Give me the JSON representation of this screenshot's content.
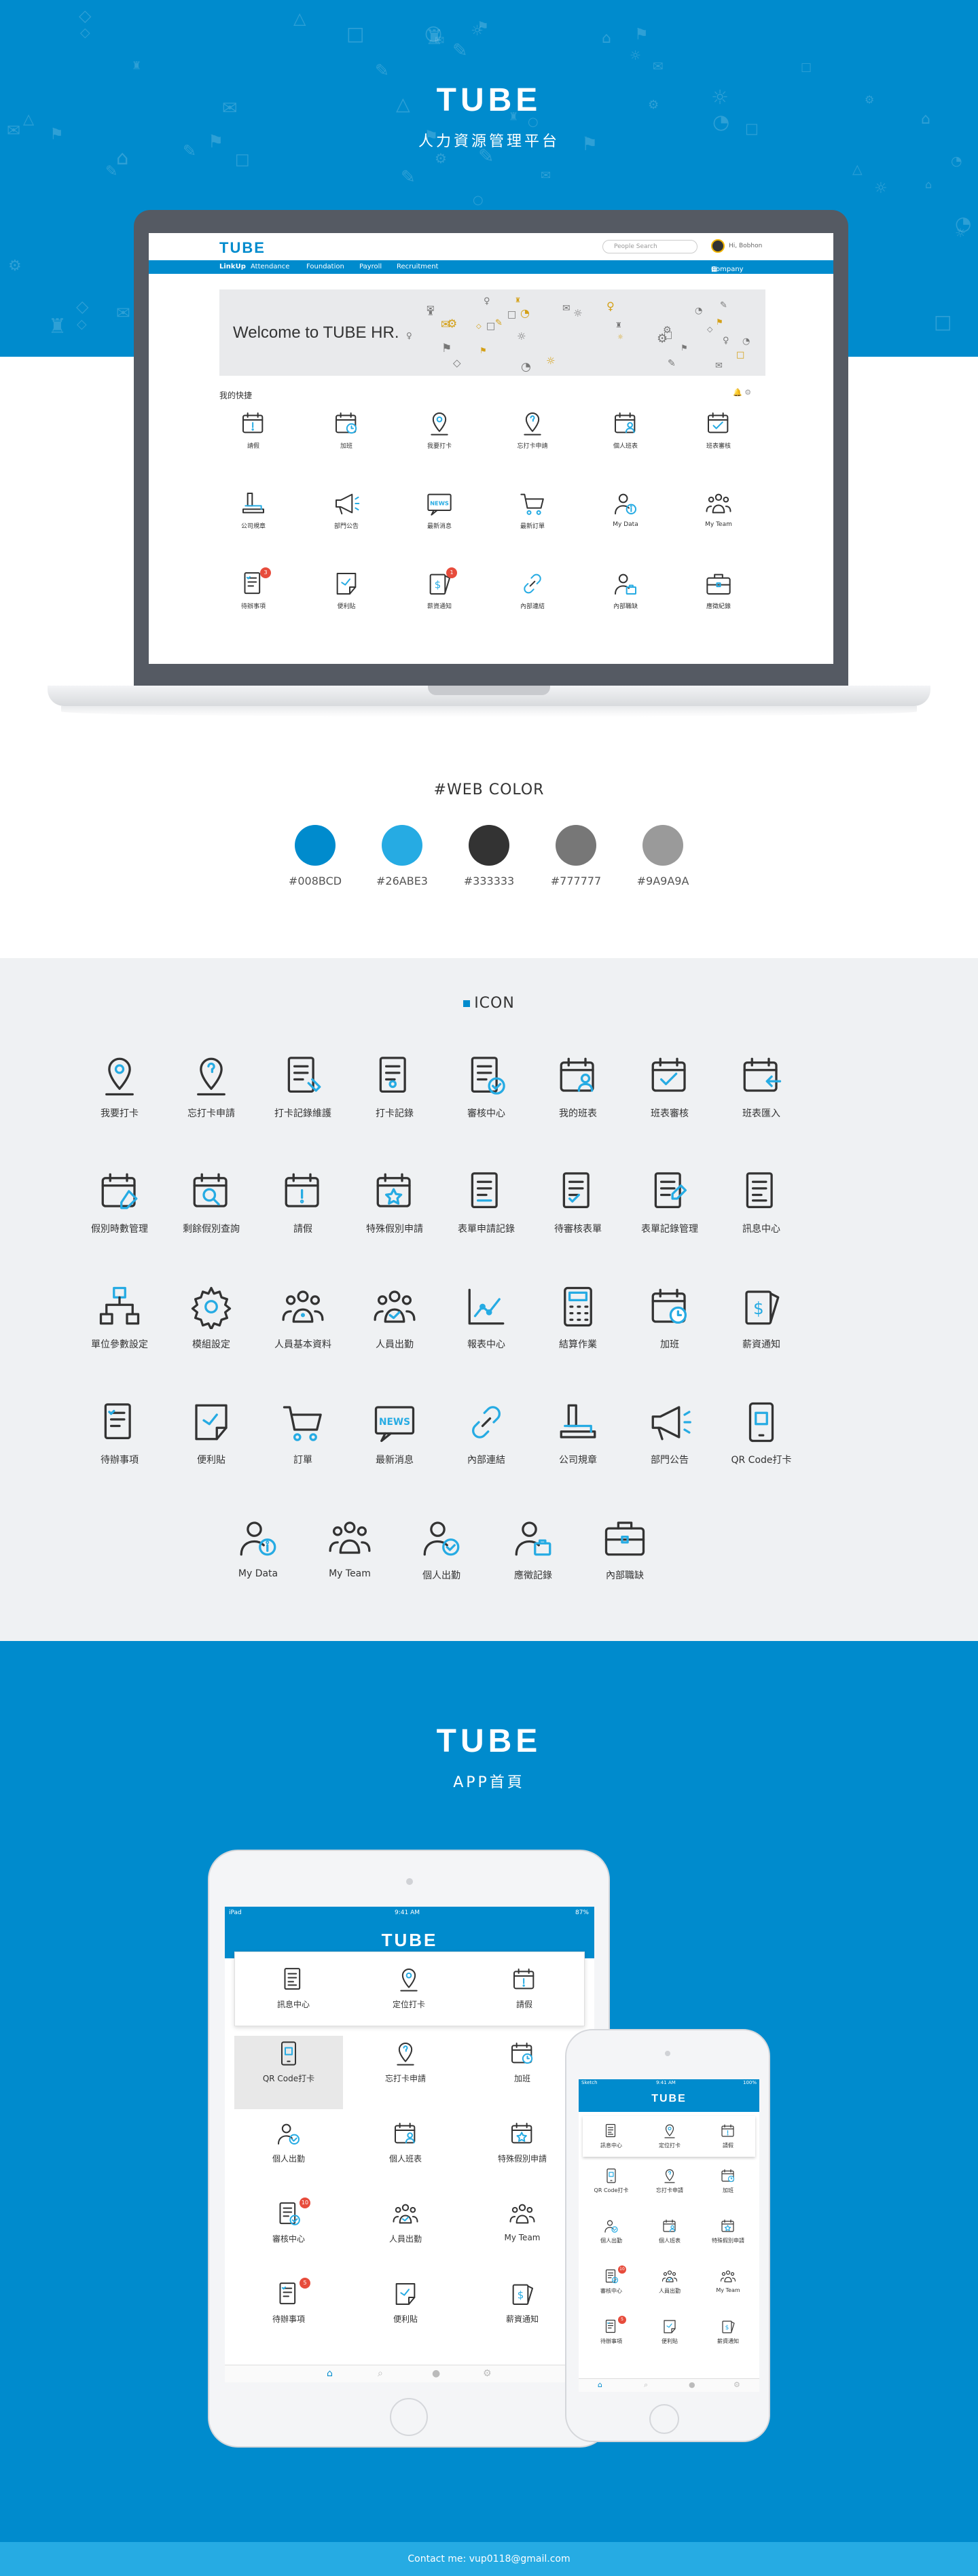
{
  "hero": {
    "logo": "TUBE",
    "subtitle": "人力資源管理平台"
  },
  "screen": {
    "logo": "TUBE",
    "search_placeholder": "People Search",
    "user_name": "Hi, Bobhon",
    "nav": [
      "LinkUp",
      "Attendance",
      "Foundation",
      "Payroll",
      "Recruitment"
    ],
    "company_space": "Company Space",
    "banner": "Welcome to TUBE HR.",
    "quick_title": "我的快捷",
    "items": [
      {
        "label": "請假",
        "icon": "calendar-alert-icon"
      },
      {
        "label": "加班",
        "icon": "calendar-clock-icon"
      },
      {
        "label": "我要打卡",
        "icon": "location-pin-icon"
      },
      {
        "label": "忘打卡申請",
        "icon": "location-question-icon"
      },
      {
        "label": "個人班表",
        "icon": "calendar-person-icon"
      },
      {
        "label": "班表審核",
        "icon": "calendar-check-icon"
      },
      {
        "label": "公司規章",
        "icon": "stamp-icon"
      },
      {
        "label": "部門公告",
        "icon": "megaphone-icon"
      },
      {
        "label": "最新消息",
        "icon": "news-icon"
      },
      {
        "label": "最新訂單",
        "icon": "cart-icon"
      },
      {
        "label": "My Data",
        "icon": "user-info-icon"
      },
      {
        "label": "My Team",
        "icon": "team-icon"
      },
      {
        "label": "待辦事項",
        "icon": "todo-icon",
        "badge": "3"
      },
      {
        "label": "便利貼",
        "icon": "sticky-note-icon"
      },
      {
        "label": "薪資通知",
        "icon": "salary-icon",
        "badge": "1"
      },
      {
        "label": "內部連結",
        "icon": "link-icon"
      },
      {
        "label": "內部職缺",
        "icon": "user-briefcase-icon"
      },
      {
        "label": "應徵紀錄",
        "icon": "briefcase-icon"
      }
    ]
  },
  "webcolor": {
    "title": "#WEB COLOR",
    "colors": [
      "#008BCD",
      "#26ABE3",
      "#333333",
      "#777777",
      "#9A9A9A"
    ]
  },
  "icons": {
    "title": "ICON",
    "items": [
      {
        "label": "我要打卡",
        "icon": "location-pin-icon"
      },
      {
        "label": "忘打卡申請",
        "icon": "location-question-icon"
      },
      {
        "label": "打卡記錄維護",
        "icon": "doc-wrench-icon"
      },
      {
        "label": "打卡記錄",
        "icon": "doc-pin-icon"
      },
      {
        "label": "審核中心",
        "icon": "doc-check-icon"
      },
      {
        "label": "我的班表",
        "icon": "calendar-person-icon"
      },
      {
        "label": "班表審核",
        "icon": "calendar-check-icon"
      },
      {
        "label": "班表匯入",
        "icon": "calendar-import-icon"
      },
      {
        "label": "假別時數管理",
        "icon": "calendar-pencil-icon"
      },
      {
        "label": "剩餘假別查詢",
        "icon": "calendar-search-icon"
      },
      {
        "label": "請假",
        "icon": "calendar-alert-icon"
      },
      {
        "label": "特殊假別申請",
        "icon": "calendar-star-icon"
      },
      {
        "label": "表單申請記錄",
        "icon": "doc-list-icon"
      },
      {
        "label": "待審核表單",
        "icon": "doc-check-list-icon"
      },
      {
        "label": "表單記錄管理",
        "icon": "doc-pencil-icon"
      },
      {
        "label": "訊息中心",
        "icon": "doc-lines-icon"
      },
      {
        "label": "單位參數設定",
        "icon": "org-chart-icon"
      },
      {
        "label": "模組設定",
        "icon": "gear-icon"
      },
      {
        "label": "人員基本資料",
        "icon": "team-info-icon"
      },
      {
        "label": "人員出勤",
        "icon": "team-check-icon"
      },
      {
        "label": "報表中心",
        "icon": "line-chart-icon"
      },
      {
        "label": "結算作業",
        "icon": "calculator-icon"
      },
      {
        "label": "加班",
        "icon": "calendar-clock-icon"
      },
      {
        "label": "薪資通知",
        "icon": "salary-icon"
      },
      {
        "label": "待辦事項",
        "icon": "todo-icon"
      },
      {
        "label": "便利貼",
        "icon": "sticky-note-icon"
      },
      {
        "label": "訂單",
        "icon": "cart-icon"
      },
      {
        "label": "最新消息",
        "icon": "news-icon"
      },
      {
        "label": "內部連結",
        "icon": "link-icon"
      },
      {
        "label": "公司規章",
        "icon": "stamp-icon"
      },
      {
        "label": "部門公告",
        "icon": "megaphone-icon"
      },
      {
        "label": "QR Code打卡",
        "icon": "qr-phone-icon"
      },
      {
        "label": "My Data",
        "icon": "user-info-icon"
      },
      {
        "label": "My Team",
        "icon": "team-icon"
      },
      {
        "label": "個人出勤",
        "icon": "user-check-icon"
      },
      {
        "label": "應徵記錄",
        "icon": "user-briefcase-icon"
      },
      {
        "label": "內部職缺",
        "icon": "briefcase-icon"
      }
    ]
  },
  "app": {
    "logo": "TUBE",
    "subtitle": "APP首頁",
    "status_carrier": "iPad",
    "status_time": "9:41 AM",
    "status_battery": "87%",
    "phone_carrier": "Sketch",
    "phone_battery": "100%",
    "top": [
      {
        "label": "訊息中心",
        "icon": "doc-lines-icon"
      },
      {
        "label": "定位打卡",
        "icon": "location-pin-icon"
      },
      {
        "label": "請假",
        "icon": "calendar-alert-icon"
      }
    ],
    "grid": [
      {
        "label": "QR Code打卡",
        "icon": "qr-phone-icon"
      },
      {
        "label": "忘打卡申請",
        "icon": "location-question-icon"
      },
      {
        "label": "加班",
        "icon": "calendar-clock-icon"
      },
      {
        "label": "個人出勤",
        "icon": "user-check-icon"
      },
      {
        "label": "個人班表",
        "icon": "calendar-person-icon"
      },
      {
        "label": "特殊假別申請",
        "icon": "calendar-star-icon"
      },
      {
        "label": "審核中心",
        "icon": "doc-check-icon",
        "badge": "10"
      },
      {
        "label": "人員出勤",
        "icon": "team-check-icon"
      },
      {
        "label": "My Team",
        "icon": "team-icon"
      },
      {
        "label": "待辦事項",
        "icon": "todo-icon",
        "badge": "5"
      },
      {
        "label": "便利貼",
        "icon": "sticky-note-icon"
      },
      {
        "label": "薪資通知",
        "icon": "salary-icon"
      }
    ]
  },
  "footer": {
    "contact": "Contact me: vup0118@gmail.com"
  }
}
